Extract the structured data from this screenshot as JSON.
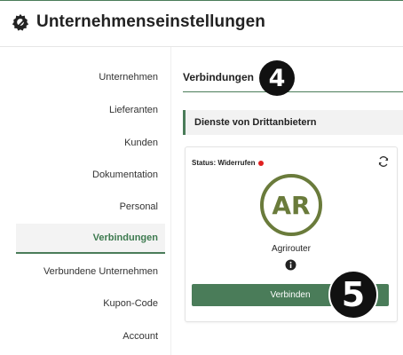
{
  "colors": {
    "accent": "#4a7c59",
    "status_red": "#e02020"
  },
  "header": {
    "title": "Unternehmenseinstellungen",
    "icon": "gear-wrench-icon"
  },
  "sidebar": {
    "items": [
      {
        "label": "Unternehmen"
      },
      {
        "label": "Lieferanten"
      },
      {
        "label": "Kunden"
      },
      {
        "label": "Dokumentation"
      },
      {
        "label": "Personal"
      },
      {
        "label": "Verbindungen",
        "active": true
      },
      {
        "label": "Verbundene Unternehmen"
      },
      {
        "label": "Kupon-Code"
      },
      {
        "label": "Account"
      }
    ]
  },
  "main": {
    "section_title": "Verbindungen",
    "panel_title": "Dienste von Drittanbietern",
    "service": {
      "status_label": "Status: Widerrufen",
      "logo_text": "AR",
      "name": "Agrirouter",
      "button_label": "Verbinden"
    }
  },
  "annotations": {
    "step4": "4",
    "step5": "5"
  }
}
